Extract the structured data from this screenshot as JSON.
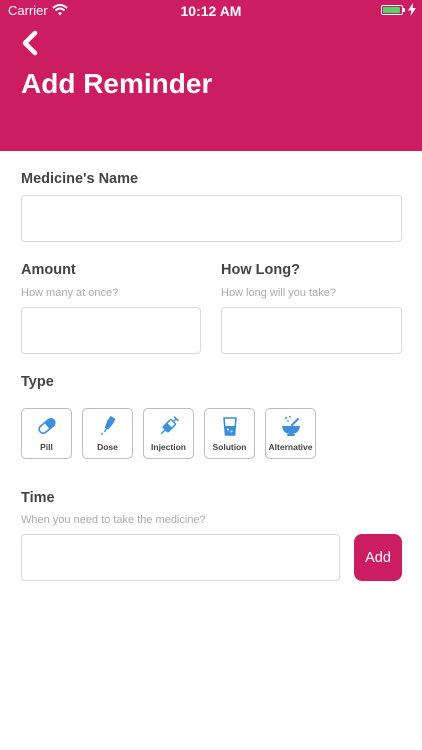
{
  "status_bar": {
    "carrier": "Carrier",
    "time": "10:12 AM",
    "battery_color": "#4cd964"
  },
  "header": {
    "title": "Add Reminder",
    "background_color": "#cc1d62",
    "back_icon": "chevron-left-icon"
  },
  "form": {
    "medicine_name": {
      "label": "Medicine's Name",
      "value": "",
      "placeholder": ""
    },
    "amount": {
      "label": "Amount",
      "hint": "How many at once?",
      "value": ""
    },
    "how_long": {
      "label": "How Long?",
      "hint": "How long will you take?",
      "value": ""
    },
    "type": {
      "label": "Type",
      "options": [
        {
          "label": "Pill",
          "icon": "pill-icon"
        },
        {
          "label": "Dose",
          "icon": "dropper-icon"
        },
        {
          "label": "Injection",
          "icon": "syringe-icon"
        },
        {
          "label": "Solution",
          "icon": "glass-icon"
        },
        {
          "label": "Alternative",
          "icon": "mortar-icon"
        }
      ]
    },
    "time": {
      "label": "Time",
      "hint": "When you need to take the medicine?",
      "value": ""
    },
    "add_button": {
      "label": "Add",
      "color": "#cc1d62"
    }
  },
  "icon_color": "#3d8fd9"
}
